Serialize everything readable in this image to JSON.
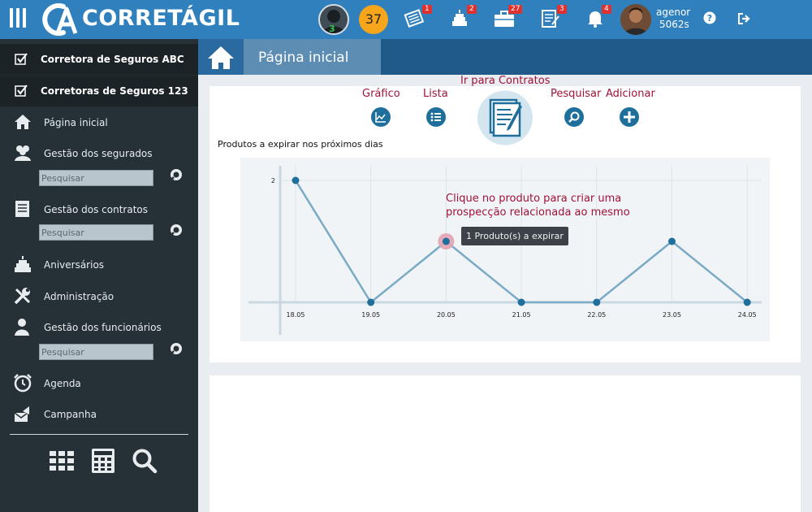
{
  "header": {
    "logo_text": "CORRETÁGIL",
    "online_count": "3",
    "points": "37",
    "notifications": [
      {
        "icon": "newspaper-icon",
        "count": "1"
      },
      {
        "icon": "birthday-cake-icon",
        "count": "2"
      },
      {
        "icon": "briefcase-icon",
        "count": "27"
      },
      {
        "icon": "contract-icon",
        "count": "3"
      },
      {
        "icon": "bell-icon",
        "count": "4"
      }
    ],
    "user_name": "agenor",
    "user_code": "5062s"
  },
  "sidebar": {
    "companies": [
      "Corretora de Seguros ABC",
      "Corretoras de Seguros 123"
    ],
    "items": [
      {
        "label": "Página inicial",
        "icon": "home-icon"
      },
      {
        "label": "Gestão dos segurados",
        "icon": "users-icon",
        "search_placeholder": "Pesquisar"
      },
      {
        "label": "Gestão dos contratos",
        "icon": "contracts-icon",
        "search_placeholder": "Pesquisar"
      },
      {
        "label": "Aniversários",
        "icon": "birthday-cake-icon"
      },
      {
        "label": "Administração",
        "icon": "tools-icon"
      },
      {
        "label": "Gestão dos funcionários",
        "icon": "employee-icon",
        "search_placeholder": "Pesquisar"
      },
      {
        "label": "Agenda",
        "icon": "alarm-clock-icon"
      },
      {
        "label": "Campanha",
        "icon": "campaign-icon"
      }
    ]
  },
  "page": {
    "title": "Página inicial"
  },
  "toolbar": {
    "chart_label": "Gráfico",
    "list_label": "Lista",
    "contracts_label": "Ir para Contratos",
    "search_label": "Pesquisar",
    "add_label": "Adicionar"
  },
  "main": {
    "section_label": "Produtos a expirar nos próximos dias",
    "hint_line1": "Clique no produto para criar uma",
    "hint_line2": "prospecção relacionada ao mesmo",
    "tooltip": "1 Produto(s) a expirar"
  },
  "colors": {
    "topbar": "#2f80bd",
    "sidebar": "#263137",
    "accent_text": "#a11237",
    "chart_line": "#7aaac4",
    "chart_point": "#1f6f9c"
  },
  "chart_data": {
    "type": "line",
    "categories": [
      "18.05",
      "19.05",
      "20.05",
      "21.05",
      "22.05",
      "23.05",
      "24.05"
    ],
    "values": [
      2,
      0,
      1,
      0,
      0,
      1,
      0
    ],
    "y_tick_labels": [
      "2"
    ],
    "ylim": [
      0,
      2
    ],
    "grid": true,
    "highlighted_index": 2
  }
}
